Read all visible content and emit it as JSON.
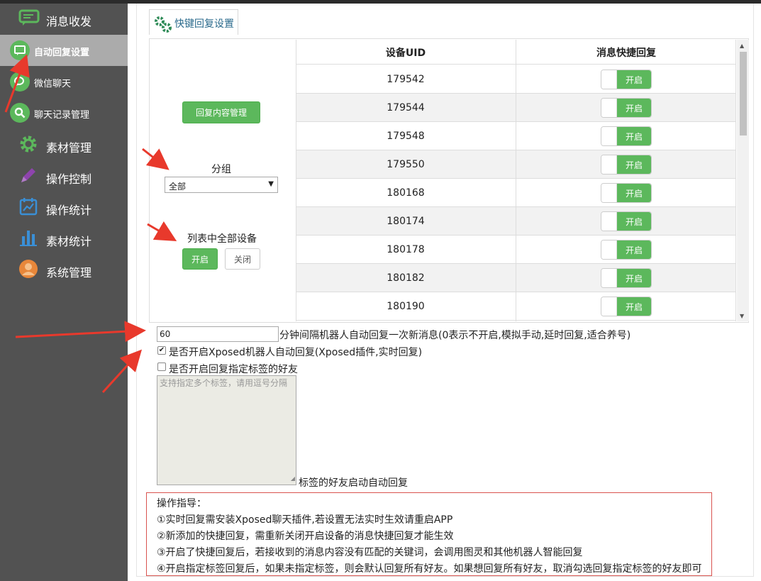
{
  "sidebar": {
    "items": [
      {
        "label": "消息收发",
        "icon": "chat-bubble-icon"
      },
      {
        "label": "自动回复设置",
        "icon": "auto-reply-icon"
      },
      {
        "label": "微信聊天",
        "icon": "wechat-icon"
      },
      {
        "label": "聊天记录管理",
        "icon": "search-icon"
      },
      {
        "label": "素材管理",
        "icon": "gear-icon"
      },
      {
        "label": "操作控制",
        "icon": "pencil-icon"
      },
      {
        "label": "操作统计",
        "icon": "line-chart-icon"
      },
      {
        "label": "素材统计",
        "icon": "bar-chart-icon"
      },
      {
        "label": "系统管理",
        "icon": "user-icon"
      }
    ]
  },
  "tab": {
    "label": "快键回复设置",
    "icon": "gears-icon"
  },
  "left": {
    "manage_button": "回复内容管理",
    "group_label": "分组",
    "group_selected": "全部",
    "all_devices_label": "列表中全部设备",
    "on_button": "开启",
    "off_button": "关闭"
  },
  "table": {
    "headers": [
      "设备UID",
      "消息快捷回复"
    ],
    "rows": [
      {
        "uid": "179542",
        "state": "开启"
      },
      {
        "uid": "179544",
        "state": "开启"
      },
      {
        "uid": "179548",
        "state": "开启"
      },
      {
        "uid": "179550",
        "state": "开启"
      },
      {
        "uid": "180168",
        "state": "开启"
      },
      {
        "uid": "180174",
        "state": "开启"
      },
      {
        "uid": "180178",
        "state": "开启"
      },
      {
        "uid": "180182",
        "state": "开启"
      },
      {
        "uid": "180190",
        "state": "开启"
      }
    ]
  },
  "settings": {
    "interval_value": "60",
    "interval_text": "分钟间隔机器人自动回复一次新消息(0表示不开启,模拟手动,延时回复,适合养号)",
    "xposed_checked": true,
    "xposed_text": "是否开启Xposed机器人自动回复(Xposed插件,实时回复)",
    "tag_checked": false,
    "tag_text": "是否开启回复指定标签的好友",
    "tag_placeholder": "支持指定多个标签，请用逗号分隔",
    "tag_suffix": "标签的好友启动自动回复"
  },
  "guide": {
    "title": "操作指导：",
    "lines": [
      "①实时回复需安装Xposed聊天插件,若设置无法实时生效请重启APP",
      "②新添加的快捷回复，需重新关闭开启设备的消息快捷回复才能生效",
      "③开启了快捷回复后，若接收到的消息内容没有匹配的关键词，会调用图灵和其他机器人智能回复",
      "④开启指定标签回复后，如果未指定标签，则会默认回复所有好友。如果想回复所有好友，取消勾选回复指定标签的好友即可"
    ]
  },
  "colors": {
    "accent": "#5cb85c",
    "sidebar": "#525252",
    "active": "#ababab",
    "annotation": "#e8392c"
  }
}
